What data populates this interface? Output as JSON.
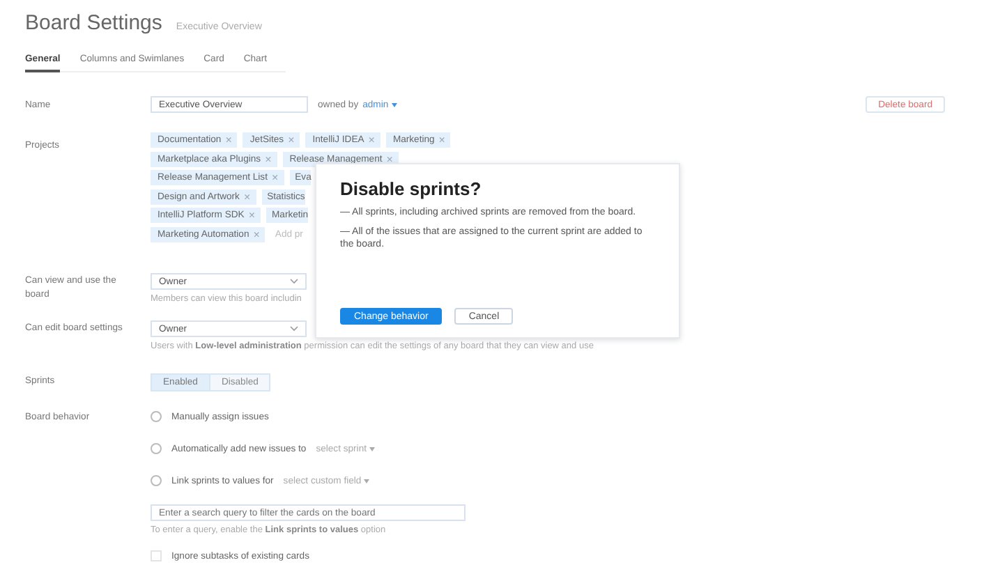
{
  "header": {
    "title": "Board Settings",
    "subtitle": "Executive Overview"
  },
  "tabs": [
    {
      "label": "General",
      "selected": true
    },
    {
      "label": "Columns and Swimlanes",
      "selected": false
    },
    {
      "label": "Card",
      "selected": false
    },
    {
      "label": "Chart",
      "selected": false
    }
  ],
  "name": {
    "label": "Name",
    "value": "Executive Overview",
    "owner_prefix": "owned by",
    "owner": "admin",
    "delete_button": "Delete board"
  },
  "projects": {
    "label": "Projects",
    "rows": [
      {
        "chips": [
          {
            "label": "Documentation",
            "remove": "×"
          },
          {
            "label": "JetSites",
            "remove": "×"
          },
          {
            "label": "IntelliJ IDEA",
            "remove": "×"
          },
          {
            "label": "Marketing",
            "remove": "×"
          }
        ]
      },
      {
        "chips": [
          {
            "label": "Marketplace aka Plugins",
            "remove": "×"
          },
          {
            "label": "Release Management",
            "remove": "×"
          }
        ]
      },
      {
        "chips": [
          {
            "label": "Release Management List",
            "remove": "×"
          },
          {
            "label": "Eva"
          }
        ]
      },
      {
        "chips": [
          {
            "label": "Design and Artwork",
            "remove": "×"
          },
          {
            "label": "Statistics"
          }
        ]
      },
      {
        "chips": [
          {
            "label": "IntelliJ Platform SDK",
            "remove": "×"
          },
          {
            "label": "Marketin"
          }
        ]
      },
      {
        "chips": [
          {
            "label": "Marketing Automation",
            "remove": "×"
          }
        ],
        "placeholder": "Add pr"
      }
    ]
  },
  "view": {
    "label": "Can view and use the board",
    "value": "Owner",
    "hint": "Members can view this board includin"
  },
  "edit": {
    "label": "Can edit board settings",
    "value": "Owner",
    "hint": "Users with **Low-level administration** permission can edit the settings of any board that they can view and use"
  },
  "sprints": {
    "label": "Sprints",
    "options": [
      {
        "label": "Enabled",
        "selected": true
      },
      {
        "label": "Disabled",
        "selected": false
      }
    ]
  },
  "behavior": {
    "label": "Board behavior",
    "options": [
      {
        "label": "Manually assign issues",
        "selected": false
      },
      {
        "label": "Automatically add new issues to",
        "link": "select sprint",
        "selected": false
      },
      {
        "label": "Link sprints to values for",
        "link": "select custom field",
        "selected": false
      }
    ],
    "query_placeholder": "Enter a search query to filter the cards on the board",
    "query_hint": "To enter a query, enable the **Link sprints to values** option",
    "ignore_subtasks": {
      "label": "Ignore subtasks of existing cards",
      "checked": false
    }
  },
  "dialog": {
    "title": "Disable sprints?",
    "lines": [
      "— All sprints, including archived sprints are removed from the board.",
      "— All of the issues that are assigned to the current sprint are added to the board."
    ],
    "buttons": [
      {
        "label": "Change behavior",
        "kind": "primary"
      },
      {
        "label": "Cancel",
        "kind": "secondary"
      }
    ]
  }
}
